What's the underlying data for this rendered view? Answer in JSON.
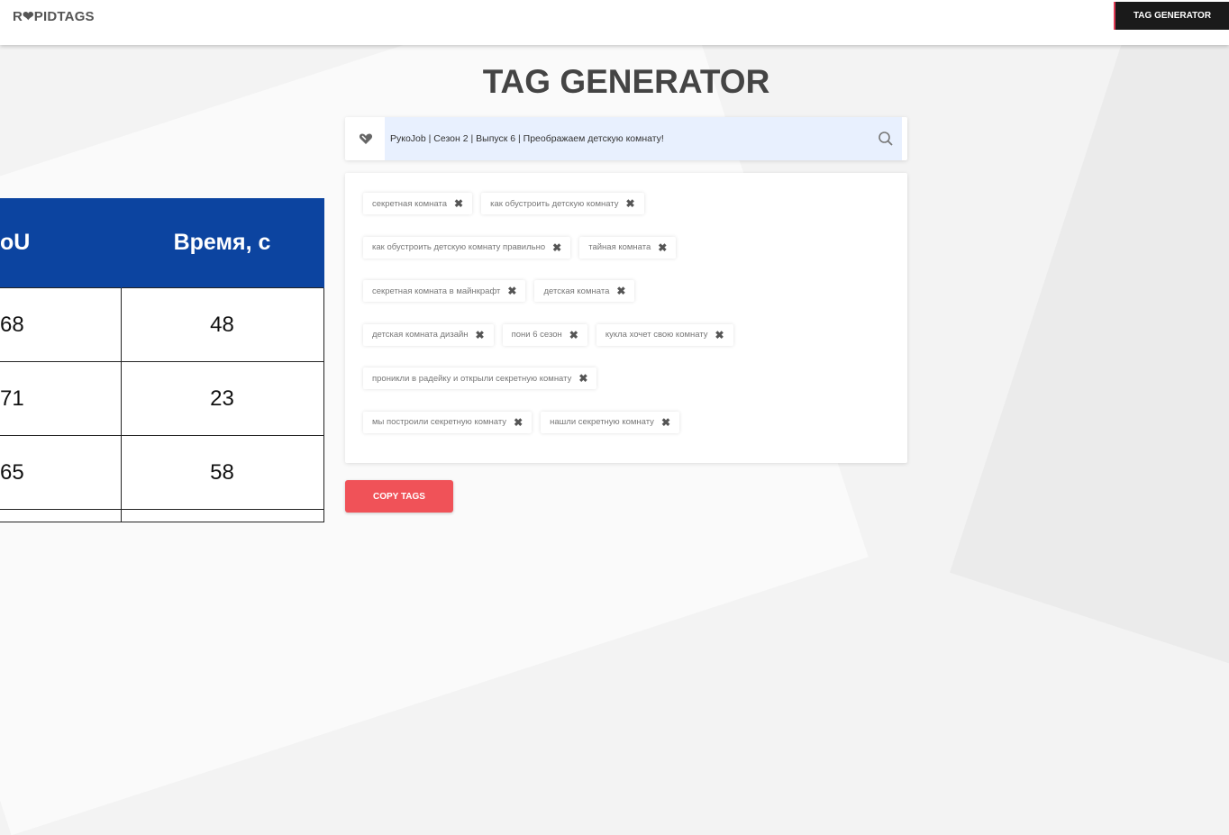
{
  "header": {
    "logo": "R❤PIDTAGS",
    "nav_button": "TAG GENERATOR"
  },
  "main": {
    "title": "TAG GENERATOR",
    "search": {
      "value": "РукоJob | Сезон 2 | Выпуск 6 | Преображаем детскую комнату!"
    },
    "tag_rows": [
      [
        "секретная комната",
        "как обустроить детскую комнату"
      ],
      [
        "как обустроить детскую комнату правильно",
        "тайная комната"
      ],
      [
        "секретная комната в майнкрафт",
        "детская комната"
      ],
      [
        "детская комната дизайн",
        "пони 6 сезон",
        "кукла хочет свою комнату"
      ],
      [
        "проникли в радейку и открыли секретную комнату"
      ],
      [
        "мы построили секретную комнату",
        "нашли секретную комнату"
      ]
    ],
    "copy_button": "COPY TAGS"
  },
  "overlay_table": {
    "headers": [
      "oU",
      "Время, с"
    ],
    "rows": [
      [
        "68",
        "48"
      ],
      [
        "71",
        "23"
      ],
      [
        "65",
        "58"
      ],
      [
        "",
        ""
      ]
    ]
  }
}
